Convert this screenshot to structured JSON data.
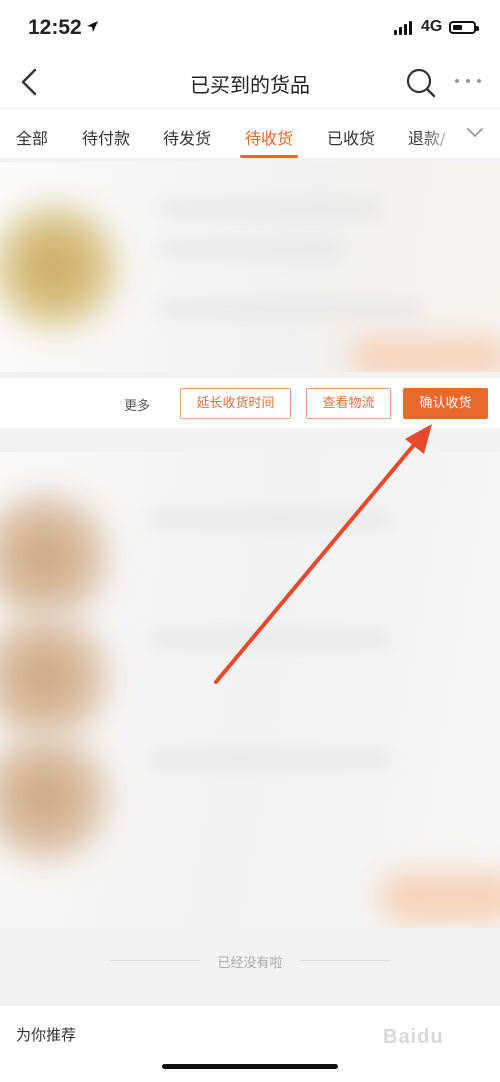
{
  "status_bar": {
    "time": "12:52",
    "network": "4G"
  },
  "navbar": {
    "title": "已买到的货品"
  },
  "tabs": [
    {
      "label": "全部"
    },
    {
      "label": "待付款"
    },
    {
      "label": "待发货"
    },
    {
      "label": "待收货",
      "active": true
    },
    {
      "label": "已收货"
    },
    {
      "label": "退款/"
    }
  ],
  "order_actions": {
    "more": "更多",
    "extend": "延长收货时间",
    "logistics": "查看物流",
    "confirm": "确认收货"
  },
  "list_end": {
    "text": "已经没有啦"
  },
  "recommend": {
    "text": "为你推荐"
  },
  "colors": {
    "accent": "#f0642a",
    "arrow": "#e8482c"
  }
}
